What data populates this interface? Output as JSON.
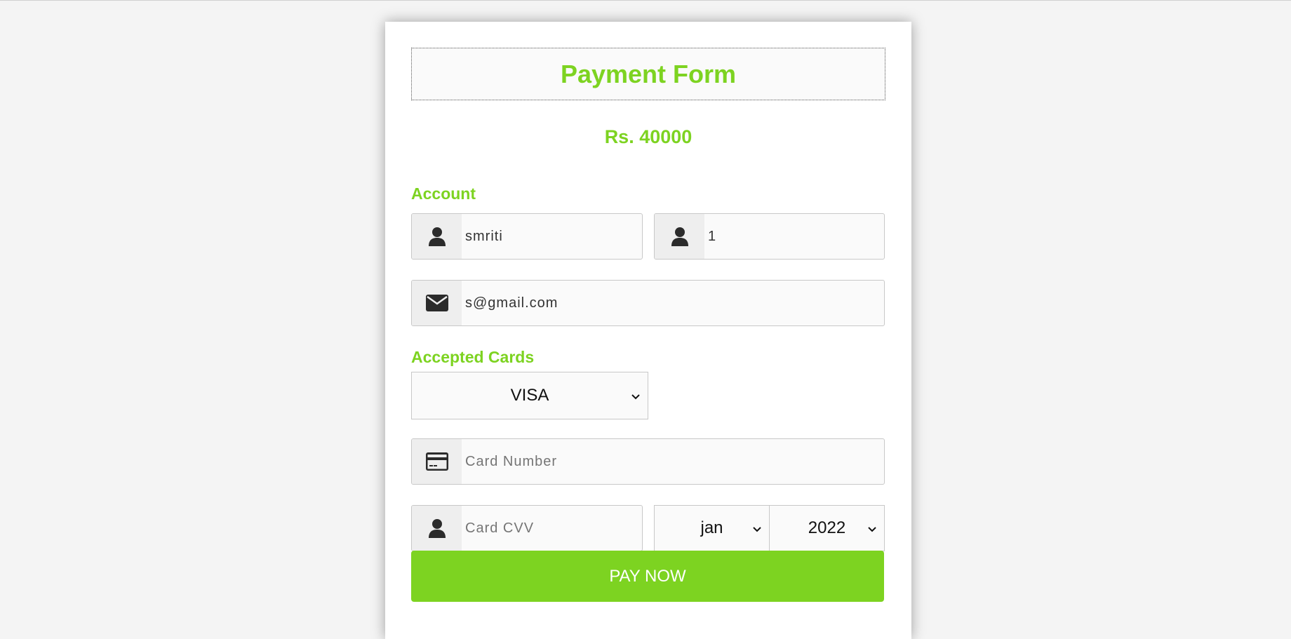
{
  "form": {
    "title": "Payment Form",
    "amount": "Rs. 40000"
  },
  "account": {
    "label": "Account",
    "name_value": "smriti",
    "second_value": "1",
    "email_value": "s@gmail.com"
  },
  "cards": {
    "label": "Accepted Cards",
    "card_type_selected": "VISA",
    "card_number_placeholder": "Card Number",
    "cvv_placeholder": "Card CVV",
    "month_selected": "jan",
    "year_selected": "2022"
  },
  "actions": {
    "pay_label": "PAY NOW"
  },
  "icons": {
    "user": "user-icon",
    "envelope": "envelope-icon",
    "credit_card": "credit-card-icon",
    "chevron": "chevron-down-icon"
  },
  "colors": {
    "accent": "#7dd321",
    "page_bg": "#f4f4f4",
    "icon": "#2b2b2b"
  }
}
